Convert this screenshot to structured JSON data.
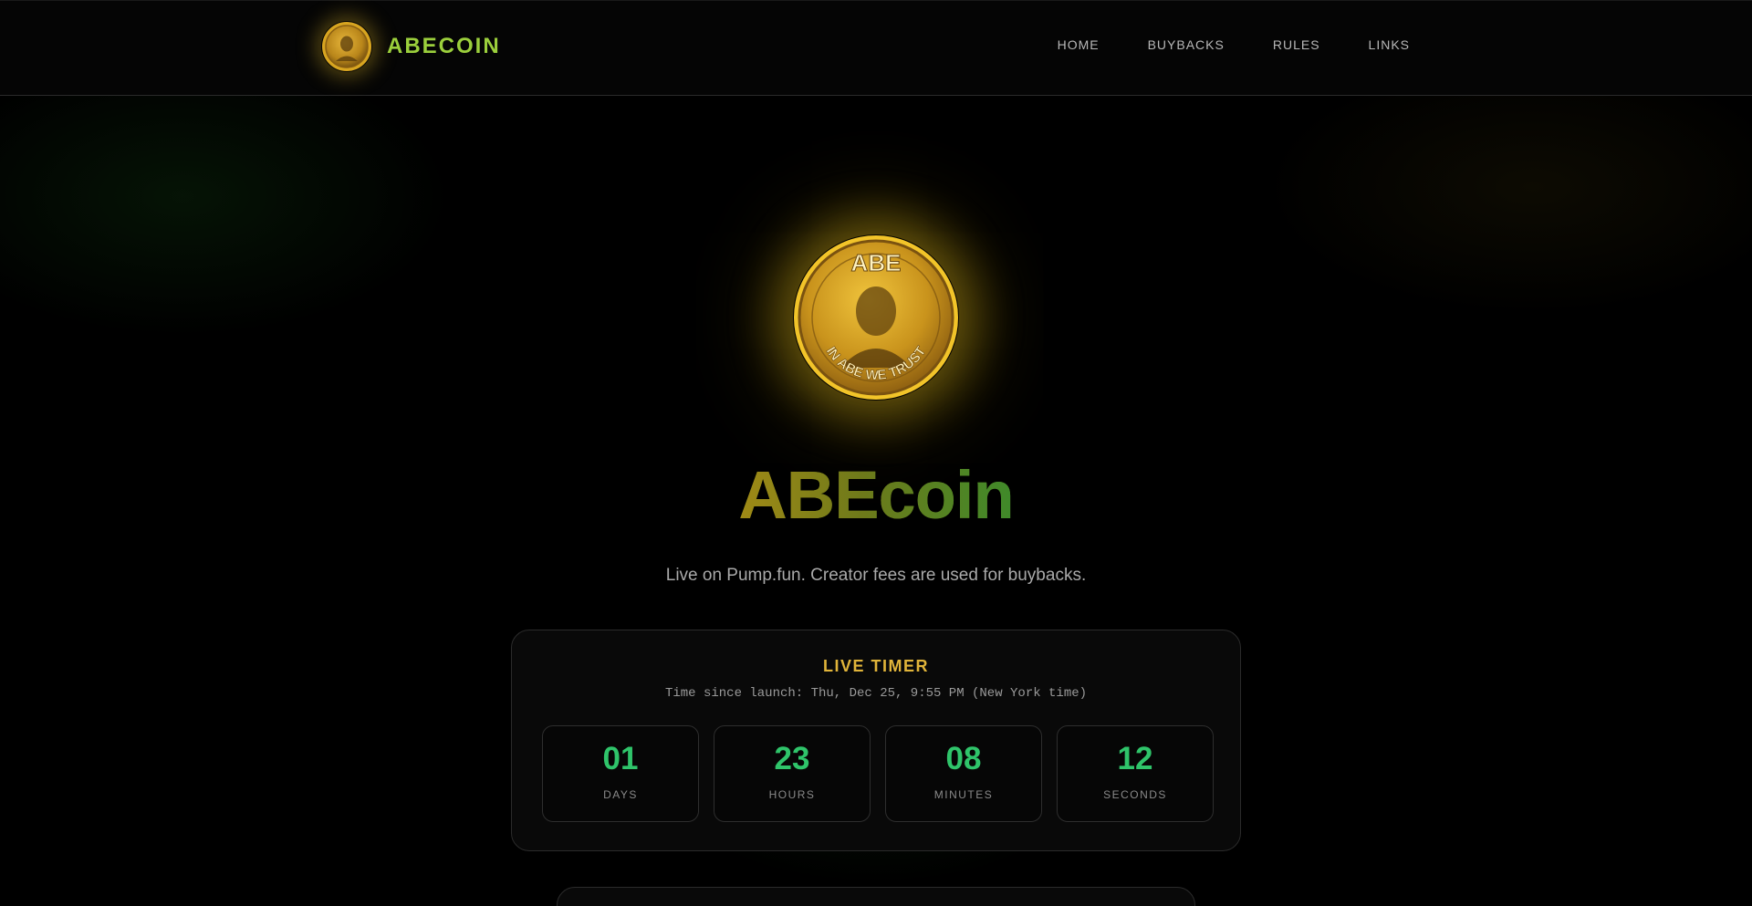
{
  "brand": {
    "name": "ABECOIN"
  },
  "nav": [
    {
      "label": "HOME"
    },
    {
      "label": "BUYBACKS"
    },
    {
      "label": "RULES"
    },
    {
      "label": "LINKS"
    }
  ],
  "coin": {
    "top_text": "ABE",
    "bottom_text": "IN ABE WE TRUST"
  },
  "hero": {
    "title": "ABEcoin",
    "subtitle": "Live on Pump.fun. Creator fees are used for buybacks."
  },
  "timer": {
    "title": "LIVE TIMER",
    "caption": "Time since launch: Thu, Dec 25, 9:55 PM (New York time)",
    "units": [
      {
        "value": "01",
        "label": "DAYS"
      },
      {
        "value": "23",
        "label": "HOURS"
      },
      {
        "value": "08",
        "label": "MINUTES"
      },
      {
        "value": "12",
        "label": "SECONDS"
      }
    ]
  },
  "colors": {
    "accent_green": "#2fc46a",
    "accent_gold": "#e0b43a",
    "brand_green": "#9bcf3c"
  }
}
